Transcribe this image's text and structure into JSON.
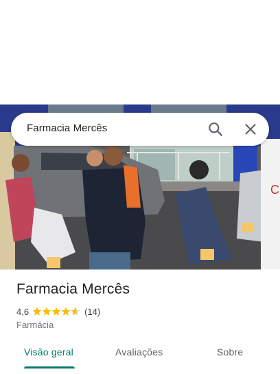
{
  "search": {
    "query": "Farmacia Mercês"
  },
  "place": {
    "name": "Farmacia Mercês",
    "rating": "4,6",
    "stars": 4.6,
    "reviews": "(14)",
    "category": "Farmácia"
  },
  "tabs": [
    {
      "label": "Visão geral",
      "active": true
    },
    {
      "label": "Avaliações",
      "active": false
    },
    {
      "label": "Sobre",
      "active": false
    }
  ],
  "colors": {
    "accent": "#00796b",
    "star": "#fbbc04",
    "text_primary": "#202124",
    "text_secondary": "#70757a"
  },
  "icons": [
    "search-icon",
    "close-icon",
    "star-icon"
  ]
}
